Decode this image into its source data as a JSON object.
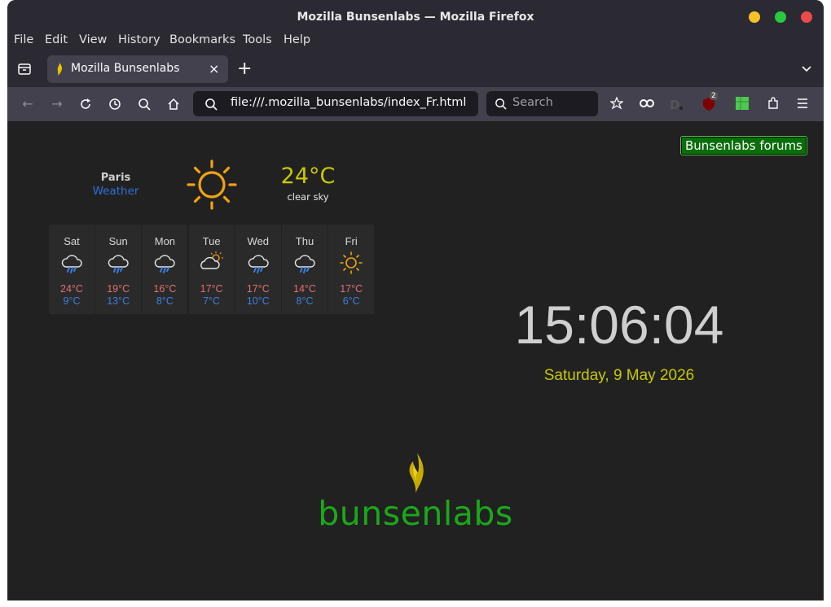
{
  "window": {
    "title": "Mozilla Bunsenlabs — Mozilla Firefox"
  },
  "menu": [
    "File",
    "Edit",
    "View",
    "History",
    "Bookmarks",
    "Tools",
    "Help"
  ],
  "tab": {
    "label": "Mozilla Bunsenlabs",
    "new_tab": "+"
  },
  "url": {
    "value": "file:///.mozilla_bunsenlabs/index_Fr.html"
  },
  "search": {
    "placeholder": "Search"
  },
  "extensions": {
    "ublock_badge": "2"
  },
  "page": {
    "forums_button": "Bunsenlabs forums",
    "weather": {
      "city": "Paris",
      "link": "Weather",
      "temp": "24°C",
      "condition": "clear sky",
      "icon": "sun-icon",
      "forecast": [
        {
          "day": "Sat",
          "hi": "24°C",
          "lo": "9°C",
          "icon": "rain-cloud-icon"
        },
        {
          "day": "Sun",
          "hi": "19°C",
          "lo": "13°C",
          "icon": "rain-cloud-icon"
        },
        {
          "day": "Mon",
          "hi": "16°C",
          "lo": "8°C",
          "icon": "rain-cloud-icon"
        },
        {
          "day": "Tue",
          "hi": "17°C",
          "lo": "7°C",
          "icon": "sun-cloud-icon"
        },
        {
          "day": "Wed",
          "hi": "17°C",
          "lo": "10°C",
          "icon": "rain-cloud-icon"
        },
        {
          "day": "Thu",
          "hi": "14°C",
          "lo": "8°C",
          "icon": "rain-cloud-icon"
        },
        {
          "day": "Fri",
          "hi": "17°C",
          "lo": "6°C",
          "icon": "sun-icon"
        }
      ]
    },
    "clock": "15:06:04",
    "date": "Saturday, 9 May 2026",
    "logo_text_a": "bunsen",
    "logo_text_b": "labs"
  },
  "colors": {
    "accent_yellow": "#c8c800",
    "brand_green": "#1aa81a",
    "link_blue": "#2f6fdb"
  }
}
